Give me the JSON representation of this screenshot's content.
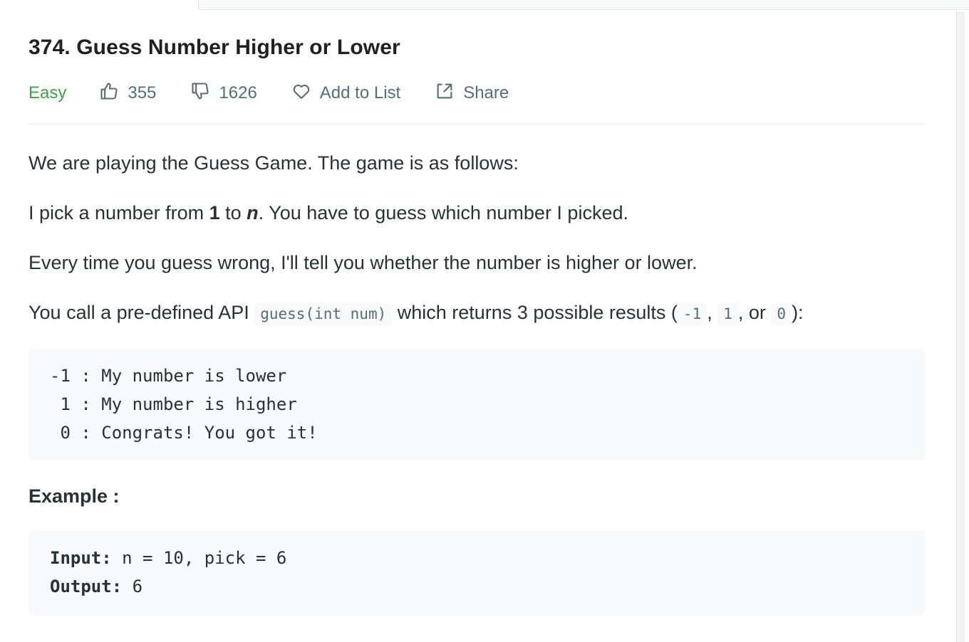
{
  "problem": {
    "title": "374. Guess Number Higher or Lower",
    "difficulty": "Easy",
    "likes": "355",
    "dislikes": "1626",
    "add_to_list_label": "Add to List",
    "share_label": "Share"
  },
  "description": {
    "p1": "We are playing the Guess Game. The game is as follows:",
    "p2_prefix": "I pick a number from ",
    "p2_one": "1",
    "p2_to": " to ",
    "p2_n": "n",
    "p2_suffix": ". You have to guess which number I picked.",
    "p3": "Every time you guess wrong, I'll tell you whether the number is higher or lower.",
    "p4_prefix": "You call a pre-defined API ",
    "p4_api": "guess(int num)",
    "p4_mid": " which returns 3 possible results (",
    "p4_r1": "-1",
    "p4_sep1": ", ",
    "p4_r2": "1",
    "p4_sep2": ", or ",
    "p4_r3": "0",
    "p4_end": "):",
    "results": [
      "-1 : My number is lower",
      " 1 : My number is higher",
      " 0 : Congrats! You got it!"
    ]
  },
  "example": {
    "heading": "Example :",
    "input_label": "Input:",
    "input_value": " n = 10, pick = 6",
    "output_label": "Output:",
    "output_value": " 6"
  },
  "colors": {
    "easy": "#43a047",
    "meta_text": "#546e7a",
    "code_bg": "#f7f9fa"
  },
  "icons": [
    "thumbs-up-icon",
    "thumbs-down-icon",
    "heart-icon",
    "share-icon"
  ]
}
